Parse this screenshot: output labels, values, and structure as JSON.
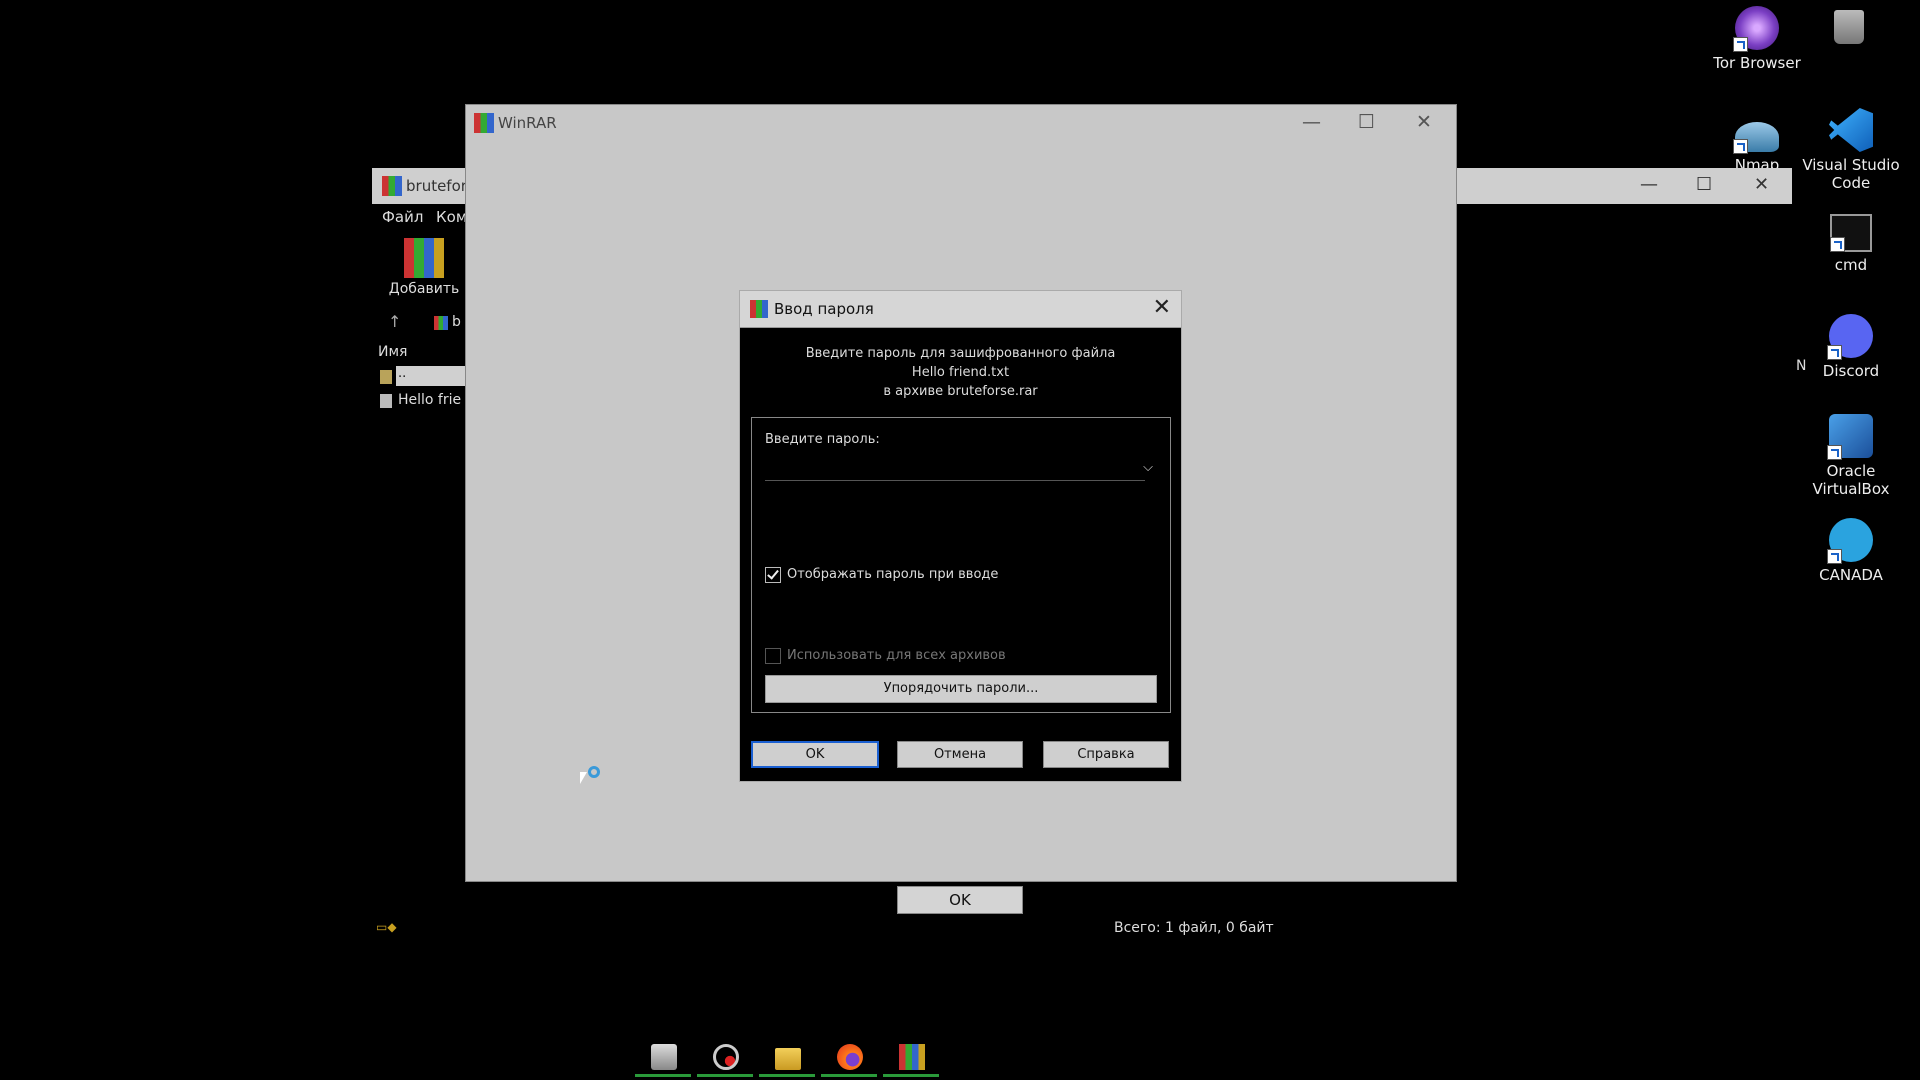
{
  "desktop": {
    "icons": [
      {
        "label": "Tor Browser",
        "color": "#7b3fc4"
      },
      {
        "label": "Nmap",
        "color": "#3a7ca8"
      },
      {
        "label": "Visual Studio Code",
        "color": "#1f8fe0"
      },
      {
        "label": "cmd",
        "color": "#222222"
      },
      {
        "label": "Discord",
        "color": "#5865f2"
      },
      {
        "label": "Oracle VirtualBox",
        "color": "#1b6ac6"
      },
      {
        "label": "CANADA",
        "color": "#2aa3df"
      }
    ],
    "recycle_bin": "recycle-bin"
  },
  "background_window": {
    "title": "brutefor",
    "menu": [
      "Файл",
      "Ком"
    ],
    "toolbar_add": "Добавить",
    "path_prefix": "b",
    "column_name": "Имя",
    "rows": [
      "..",
      "Hello frie"
    ],
    "partial_column": "N",
    "status_total": "Всего: 1 файл, 0 байт"
  },
  "winrar_window": {
    "title": "WinRAR",
    "ok_label": "OK"
  },
  "password_dialog": {
    "title": "Ввод пароля",
    "info_line1": "Введите пароль для зашифрованного файла",
    "info_line2": "Hello friend.txt",
    "info_line3": "в архиве bruteforse.rar",
    "password_label": "Введите пароль:",
    "password_value": "",
    "show_password_label": "Отображать пароль при вводе",
    "show_password_checked": true,
    "use_all_label": "Использовать для всех архивов",
    "use_all_checked": false,
    "organize_label": "Упорядочить пароли...",
    "ok_label": "OK",
    "cancel_label": "Отмена",
    "help_label": "Справка"
  },
  "taskbar": {
    "apps": [
      "computer",
      "browser-app",
      "file-explorer",
      "firefox",
      "winrar"
    ]
  }
}
